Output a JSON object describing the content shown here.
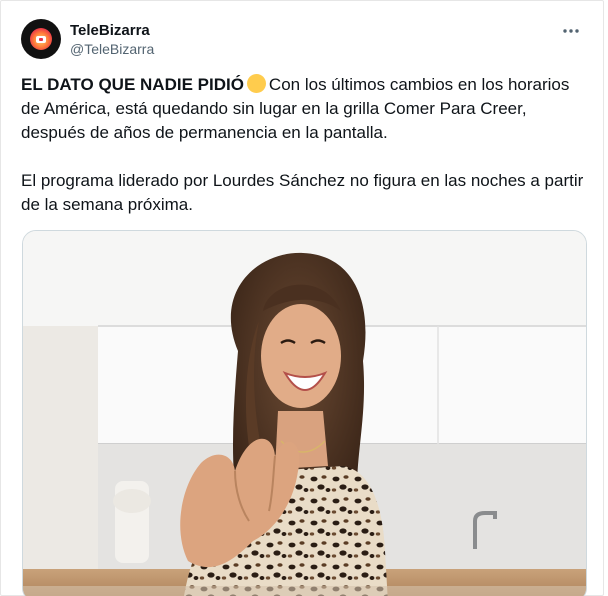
{
  "account": {
    "display_name": "TeleBizarra",
    "handle": "@TeleBizarra",
    "avatar_icon": "tv-avatar-icon"
  },
  "menu": {
    "more_icon": "more-horizontal-icon"
  },
  "tweet": {
    "headline": "EL DATO QUE NADIE PIDIÓ",
    "emoji": "yellow-circle-emoji",
    "paragraph1": "Con los últimos cambios en los horarios de América, está quedando sin lugar en la grilla Comer Para Creer, después de años de permanencia en la pantalla.",
    "paragraph2": "El programa liderado por Lourdes Sánchez no figura en las noches a partir de la semana próxima."
  },
  "media": {
    "kind": "photo",
    "description_icon": "photo-of-host-in-kitchen"
  },
  "colors": {
    "text": "#0f1419",
    "secondary": "#536471",
    "border": "#cfd9de",
    "emoji": "#ffcc4d"
  }
}
